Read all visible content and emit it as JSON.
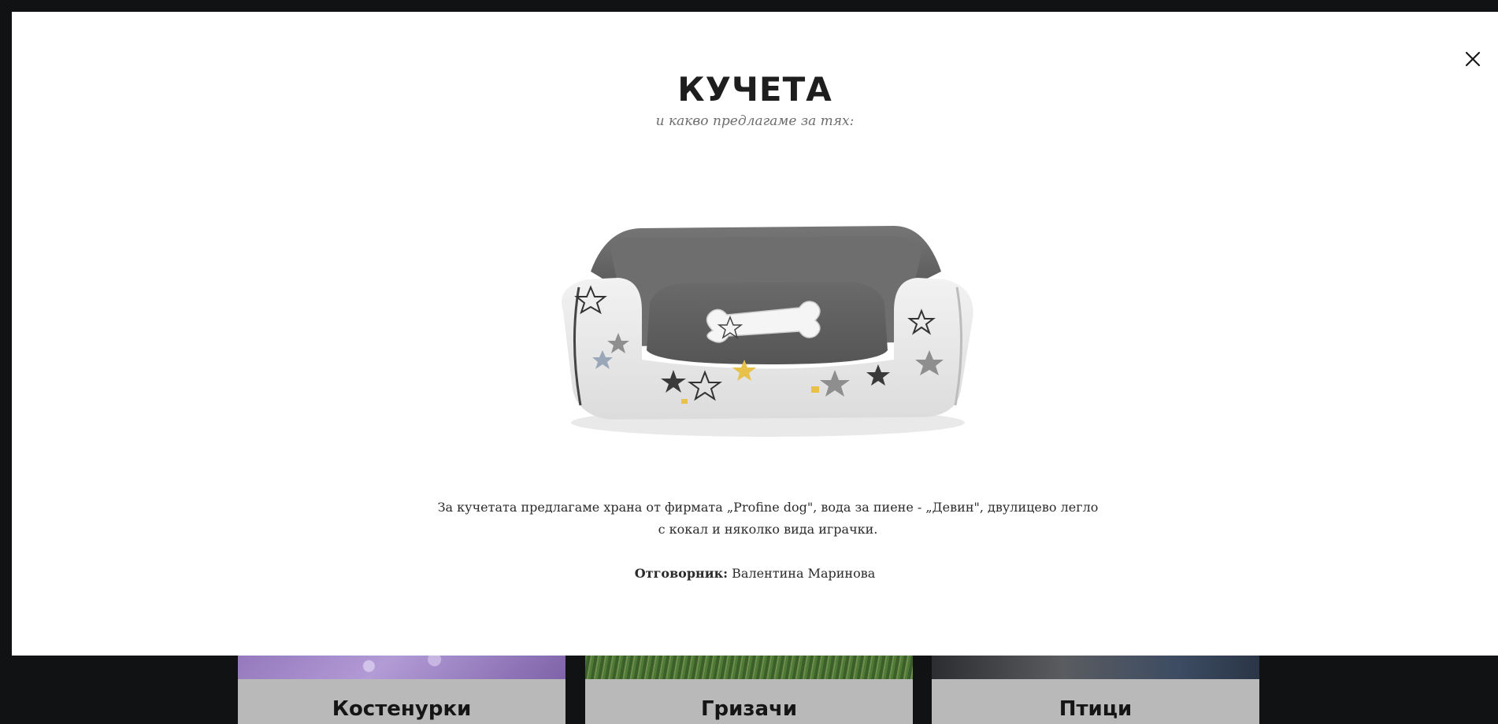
{
  "background": {
    "cards": [
      {
        "label": "Костенурки"
      },
      {
        "label": "Гризачи"
      },
      {
        "label": "Птици"
      }
    ]
  },
  "modal": {
    "title": "КУЧЕТА",
    "subtitle": "и какво предлагаме за тях:",
    "image": {
      "icon": "dog-bed-with-bone-toy"
    },
    "description": "За кучетата предлагаме храна от фирмата „Profine dog\", вода за пиене - „Девин\", двулицево легло с кокал и няколко вида играчки.",
    "responsible_label": "Отговорник:",
    "responsible_name": "Валентина Маринова",
    "close_icon": "close-icon"
  },
  "colors": {
    "overlay": "#101214",
    "modal_bg": "#ffffff",
    "title": "#1e1e1e",
    "subtitle": "#6d6d6d",
    "text": "#2b2b2b",
    "card_caption_bg": "#b9b9b9"
  }
}
